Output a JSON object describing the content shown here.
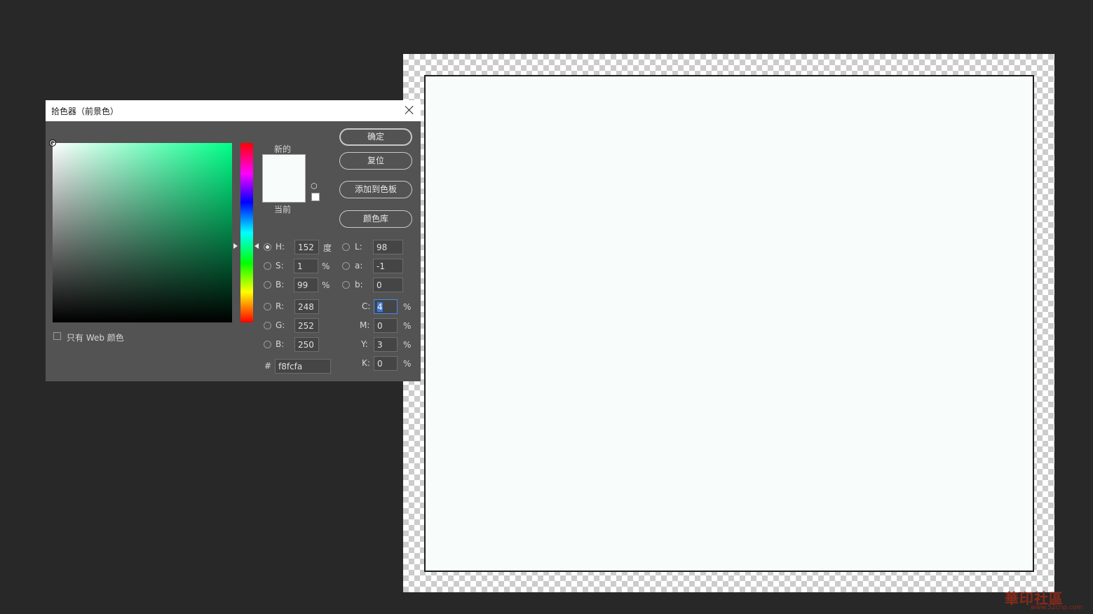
{
  "dialog": {
    "title": "拾色器（前景色）",
    "new_label": "新的",
    "current_label": "当前",
    "buttons": {
      "ok": "确定",
      "reset": "复位",
      "add_to_swatches": "添加到色板",
      "color_libraries": "颜色库"
    },
    "only_web_colors": "只有 Web 颜色",
    "hsb": {
      "h": {
        "label": "H:",
        "value": "152",
        "unit": "度",
        "selected": true
      },
      "s": {
        "label": "S:",
        "value": "1",
        "unit": "%"
      },
      "b": {
        "label": "B:",
        "value": "99",
        "unit": "%"
      }
    },
    "lab": {
      "l": {
        "label": "L:",
        "value": "98"
      },
      "a": {
        "label": "a:",
        "value": "-1"
      },
      "b": {
        "label": "b:",
        "value": "0"
      }
    },
    "rgb": {
      "r": {
        "label": "R:",
        "value": "248"
      },
      "g": {
        "label": "G:",
        "value": "252"
      },
      "b": {
        "label": "B:",
        "value": "250"
      }
    },
    "cmyk": {
      "c": {
        "label": "C:",
        "value": "4",
        "unit": "%"
      },
      "m": {
        "label": "M:",
        "value": "0",
        "unit": "%"
      },
      "y": {
        "label": "Y:",
        "value": "3",
        "unit": "%"
      },
      "k": {
        "label": "K:",
        "value": "0",
        "unit": "%"
      }
    },
    "hex": {
      "label": "#",
      "value": "f8fcfa"
    }
  },
  "canvas": {
    "fill_color": "#f8fcfa"
  },
  "icons": {
    "close": "close-icon",
    "gamut_warning": "cube-icon",
    "web_safe": "web-safe-swatch-icon"
  },
  "watermark": {
    "text": "華印社區",
    "url": "www.52cnp.com"
  }
}
